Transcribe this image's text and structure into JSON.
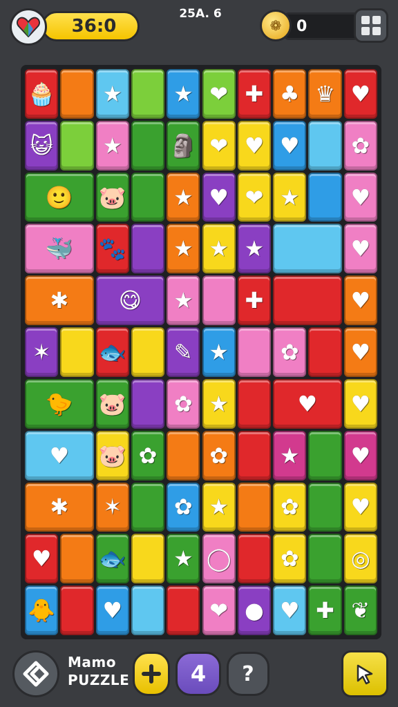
{
  "header": {
    "score": "36:0",
    "center_label": "25A. 6",
    "coins": "0",
    "heart_icon": "heart-badge-icon",
    "coin_icon": "coin-icon",
    "menu_icon": "grid-menu-icon"
  },
  "footer": {
    "title_line1": "Mamo",
    "title_line2": "PUZZLE",
    "moves": "4",
    "help": "?",
    "back_icon": "diamond-arrow-icon",
    "plus_icon": "plus-icon",
    "cursor_icon": "cursor-arrow-icon"
  },
  "colors": {
    "R": "#e0282b",
    "O": "#f47b15",
    "Y": "#f8d81c",
    "G": "#3aa12f",
    "LG": "#7ccf3b",
    "B": "#2f9de6",
    "LB": "#5fc7f0",
    "P": "#8a3fc2",
    "PK": "#f07fc4",
    "M": "#d23a8e"
  },
  "board": {
    "rows": [
      [
        {
          "c": "R",
          "g": "🧁"
        },
        {
          "c": "O",
          "g": ""
        },
        {
          "c": "LB",
          "g": "★"
        },
        {
          "c": "LG",
          "g": ""
        },
        {
          "c": "B",
          "g": "★"
        },
        {
          "c": "LG",
          "g": "❤"
        },
        {
          "c": "R",
          "g": "✚"
        },
        {
          "c": "O",
          "g": "♣"
        },
        {
          "c": "O",
          "g": "♛"
        },
        {
          "c": "R",
          "g": "♥"
        }
      ],
      [
        {
          "c": "P",
          "g": "😺"
        },
        {
          "c": "LG",
          "g": ""
        },
        {
          "c": "PK",
          "g": "★"
        },
        {
          "c": "G",
          "g": ""
        },
        {
          "c": "G",
          "g": "🗿"
        },
        {
          "c": "Y",
          "g": "❤"
        },
        {
          "c": "Y",
          "g": "♥"
        },
        {
          "c": "B",
          "g": "♥"
        },
        {
          "c": "LB",
          "g": ""
        },
        {
          "c": "PK",
          "g": "✿"
        }
      ],
      [
        {
          "c": "G",
          "g": "🙂",
          "span": 2
        },
        {
          "c": "G",
          "g": "🐷"
        },
        {
          "c": "G",
          "g": ""
        },
        {
          "c": "O",
          "g": "★"
        },
        {
          "c": "P",
          "g": "♥"
        },
        {
          "c": "Y",
          "g": "❤"
        },
        {
          "c": "Y",
          "g": "★"
        },
        {
          "c": "B",
          "g": ""
        },
        {
          "c": "PK",
          "g": "♥"
        }
      ],
      [
        {
          "c": "PK",
          "g": "🐳",
          "span": 2
        },
        {
          "c": "R",
          "g": "🐾"
        },
        {
          "c": "P",
          "g": ""
        },
        {
          "c": "O",
          "g": "★"
        },
        {
          "c": "Y",
          "g": "★"
        },
        {
          "c": "P",
          "g": "★"
        },
        {
          "c": "LB",
          "g": "",
          "span": 2
        },
        {
          "c": "PK",
          "g": "♥"
        }
      ],
      [
        {
          "c": "O",
          "g": "✱",
          "span": 2
        },
        {
          "c": "P",
          "g": "😋",
          "span": 2
        },
        {
          "c": "PK",
          "g": "★"
        },
        {
          "c": "PK",
          "g": ""
        },
        {
          "c": "R",
          "g": "✚"
        },
        {
          "c": "R",
          "g": "",
          "span": 2
        },
        {
          "c": "O",
          "g": "♥"
        }
      ],
      [
        {
          "c": "P",
          "g": "✶"
        },
        {
          "c": "Y",
          "g": ""
        },
        {
          "c": "R",
          "g": "🐟"
        },
        {
          "c": "Y",
          "g": ""
        },
        {
          "c": "P",
          "g": "✎"
        },
        {
          "c": "B",
          "g": "★"
        },
        {
          "c": "PK",
          "g": ""
        },
        {
          "c": "PK",
          "g": "✿"
        },
        {
          "c": "R",
          "g": ""
        },
        {
          "c": "O",
          "g": "♥"
        }
      ],
      [
        {
          "c": "G",
          "g": "🐤",
          "span": 2
        },
        {
          "c": "G",
          "g": "🐷"
        },
        {
          "c": "P",
          "g": ""
        },
        {
          "c": "PK",
          "g": "✿"
        },
        {
          "c": "Y",
          "g": "★"
        },
        {
          "c": "R",
          "g": ""
        },
        {
          "c": "R",
          "g": "♥",
          "span": 2
        },
        {
          "c": "Y",
          "g": "♥"
        }
      ],
      [
        {
          "c": "LB",
          "g": "♥",
          "span": 2
        },
        {
          "c": "Y",
          "g": "🐷"
        },
        {
          "c": "G",
          "g": "✿"
        },
        {
          "c": "O",
          "g": ""
        },
        {
          "c": "O",
          "g": "✿"
        },
        {
          "c": "R",
          "g": ""
        },
        {
          "c": "M",
          "g": "★"
        },
        {
          "c": "G",
          "g": ""
        },
        {
          "c": "M",
          "g": "♥"
        }
      ],
      [
        {
          "c": "O",
          "g": "✱",
          "span": 2
        },
        {
          "c": "O",
          "g": "✶"
        },
        {
          "c": "G",
          "g": ""
        },
        {
          "c": "B",
          "g": "✿"
        },
        {
          "c": "Y",
          "g": "★"
        },
        {
          "c": "O",
          "g": ""
        },
        {
          "c": "Y",
          "g": "✿"
        },
        {
          "c": "G",
          "g": ""
        },
        {
          "c": "Y",
          "g": "♥"
        }
      ],
      [
        {
          "c": "R",
          "g": "♥"
        },
        {
          "c": "O",
          "g": ""
        },
        {
          "c": "G",
          "g": "🐟"
        },
        {
          "c": "Y",
          "g": ""
        },
        {
          "c": "G",
          "g": "★"
        },
        {
          "c": "PK",
          "g": "◯"
        },
        {
          "c": "R",
          "g": ""
        },
        {
          "c": "Y",
          "g": "✿"
        },
        {
          "c": "G",
          "g": ""
        },
        {
          "c": "Y",
          "g": "◎"
        }
      ],
      [
        {
          "c": "B",
          "g": "🐥"
        },
        {
          "c": "R",
          "g": ""
        },
        {
          "c": "B",
          "g": "♥"
        },
        {
          "c": "LB",
          "g": ""
        },
        {
          "c": "R",
          "g": ""
        },
        {
          "c": "PK",
          "g": "❤"
        },
        {
          "c": "P",
          "g": "●"
        },
        {
          "c": "LB",
          "g": "♥"
        },
        {
          "c": "G",
          "g": "✚"
        },
        {
          "c": "G",
          "g": "❦"
        }
      ]
    ]
  }
}
